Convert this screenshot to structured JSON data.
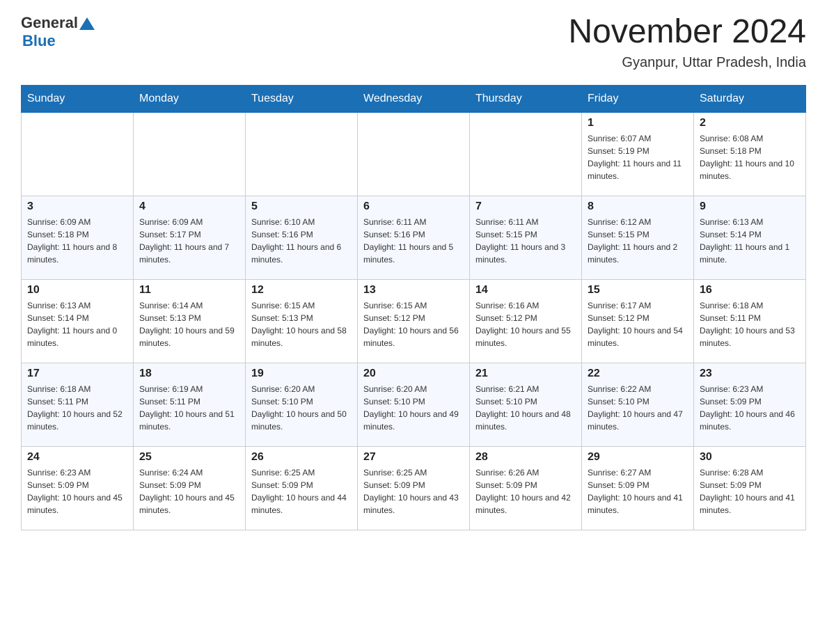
{
  "header": {
    "logo_general": "General",
    "logo_blue": "Blue",
    "month_title": "November 2024",
    "location": "Gyanpur, Uttar Pradesh, India"
  },
  "weekdays": [
    "Sunday",
    "Monday",
    "Tuesday",
    "Wednesday",
    "Thursday",
    "Friday",
    "Saturday"
  ],
  "weeks": [
    [
      {
        "day": "",
        "sunrise": "",
        "sunset": "",
        "daylight": ""
      },
      {
        "day": "",
        "sunrise": "",
        "sunset": "",
        "daylight": ""
      },
      {
        "day": "",
        "sunrise": "",
        "sunset": "",
        "daylight": ""
      },
      {
        "day": "",
        "sunrise": "",
        "sunset": "",
        "daylight": ""
      },
      {
        "day": "",
        "sunrise": "",
        "sunset": "",
        "daylight": ""
      },
      {
        "day": "1",
        "sunrise": "Sunrise: 6:07 AM",
        "sunset": "Sunset: 5:19 PM",
        "daylight": "Daylight: 11 hours and 11 minutes."
      },
      {
        "day": "2",
        "sunrise": "Sunrise: 6:08 AM",
        "sunset": "Sunset: 5:18 PM",
        "daylight": "Daylight: 11 hours and 10 minutes."
      }
    ],
    [
      {
        "day": "3",
        "sunrise": "Sunrise: 6:09 AM",
        "sunset": "Sunset: 5:18 PM",
        "daylight": "Daylight: 11 hours and 8 minutes."
      },
      {
        "day": "4",
        "sunrise": "Sunrise: 6:09 AM",
        "sunset": "Sunset: 5:17 PM",
        "daylight": "Daylight: 11 hours and 7 minutes."
      },
      {
        "day": "5",
        "sunrise": "Sunrise: 6:10 AM",
        "sunset": "Sunset: 5:16 PM",
        "daylight": "Daylight: 11 hours and 6 minutes."
      },
      {
        "day": "6",
        "sunrise": "Sunrise: 6:11 AM",
        "sunset": "Sunset: 5:16 PM",
        "daylight": "Daylight: 11 hours and 5 minutes."
      },
      {
        "day": "7",
        "sunrise": "Sunrise: 6:11 AM",
        "sunset": "Sunset: 5:15 PM",
        "daylight": "Daylight: 11 hours and 3 minutes."
      },
      {
        "day": "8",
        "sunrise": "Sunrise: 6:12 AM",
        "sunset": "Sunset: 5:15 PM",
        "daylight": "Daylight: 11 hours and 2 minutes."
      },
      {
        "day": "9",
        "sunrise": "Sunrise: 6:13 AM",
        "sunset": "Sunset: 5:14 PM",
        "daylight": "Daylight: 11 hours and 1 minute."
      }
    ],
    [
      {
        "day": "10",
        "sunrise": "Sunrise: 6:13 AM",
        "sunset": "Sunset: 5:14 PM",
        "daylight": "Daylight: 11 hours and 0 minutes."
      },
      {
        "day": "11",
        "sunrise": "Sunrise: 6:14 AM",
        "sunset": "Sunset: 5:13 PM",
        "daylight": "Daylight: 10 hours and 59 minutes."
      },
      {
        "day": "12",
        "sunrise": "Sunrise: 6:15 AM",
        "sunset": "Sunset: 5:13 PM",
        "daylight": "Daylight: 10 hours and 58 minutes."
      },
      {
        "day": "13",
        "sunrise": "Sunrise: 6:15 AM",
        "sunset": "Sunset: 5:12 PM",
        "daylight": "Daylight: 10 hours and 56 minutes."
      },
      {
        "day": "14",
        "sunrise": "Sunrise: 6:16 AM",
        "sunset": "Sunset: 5:12 PM",
        "daylight": "Daylight: 10 hours and 55 minutes."
      },
      {
        "day": "15",
        "sunrise": "Sunrise: 6:17 AM",
        "sunset": "Sunset: 5:12 PM",
        "daylight": "Daylight: 10 hours and 54 minutes."
      },
      {
        "day": "16",
        "sunrise": "Sunrise: 6:18 AM",
        "sunset": "Sunset: 5:11 PM",
        "daylight": "Daylight: 10 hours and 53 minutes."
      }
    ],
    [
      {
        "day": "17",
        "sunrise": "Sunrise: 6:18 AM",
        "sunset": "Sunset: 5:11 PM",
        "daylight": "Daylight: 10 hours and 52 minutes."
      },
      {
        "day": "18",
        "sunrise": "Sunrise: 6:19 AM",
        "sunset": "Sunset: 5:11 PM",
        "daylight": "Daylight: 10 hours and 51 minutes."
      },
      {
        "day": "19",
        "sunrise": "Sunrise: 6:20 AM",
        "sunset": "Sunset: 5:10 PM",
        "daylight": "Daylight: 10 hours and 50 minutes."
      },
      {
        "day": "20",
        "sunrise": "Sunrise: 6:20 AM",
        "sunset": "Sunset: 5:10 PM",
        "daylight": "Daylight: 10 hours and 49 minutes."
      },
      {
        "day": "21",
        "sunrise": "Sunrise: 6:21 AM",
        "sunset": "Sunset: 5:10 PM",
        "daylight": "Daylight: 10 hours and 48 minutes."
      },
      {
        "day": "22",
        "sunrise": "Sunrise: 6:22 AM",
        "sunset": "Sunset: 5:10 PM",
        "daylight": "Daylight: 10 hours and 47 minutes."
      },
      {
        "day": "23",
        "sunrise": "Sunrise: 6:23 AM",
        "sunset": "Sunset: 5:09 PM",
        "daylight": "Daylight: 10 hours and 46 minutes."
      }
    ],
    [
      {
        "day": "24",
        "sunrise": "Sunrise: 6:23 AM",
        "sunset": "Sunset: 5:09 PM",
        "daylight": "Daylight: 10 hours and 45 minutes."
      },
      {
        "day": "25",
        "sunrise": "Sunrise: 6:24 AM",
        "sunset": "Sunset: 5:09 PM",
        "daylight": "Daylight: 10 hours and 45 minutes."
      },
      {
        "day": "26",
        "sunrise": "Sunrise: 6:25 AM",
        "sunset": "Sunset: 5:09 PM",
        "daylight": "Daylight: 10 hours and 44 minutes."
      },
      {
        "day": "27",
        "sunrise": "Sunrise: 6:25 AM",
        "sunset": "Sunset: 5:09 PM",
        "daylight": "Daylight: 10 hours and 43 minutes."
      },
      {
        "day": "28",
        "sunrise": "Sunrise: 6:26 AM",
        "sunset": "Sunset: 5:09 PM",
        "daylight": "Daylight: 10 hours and 42 minutes."
      },
      {
        "day": "29",
        "sunrise": "Sunrise: 6:27 AM",
        "sunset": "Sunset: 5:09 PM",
        "daylight": "Daylight: 10 hours and 41 minutes."
      },
      {
        "day": "30",
        "sunrise": "Sunrise: 6:28 AM",
        "sunset": "Sunset: 5:09 PM",
        "daylight": "Daylight: 10 hours and 41 minutes."
      }
    ]
  ]
}
